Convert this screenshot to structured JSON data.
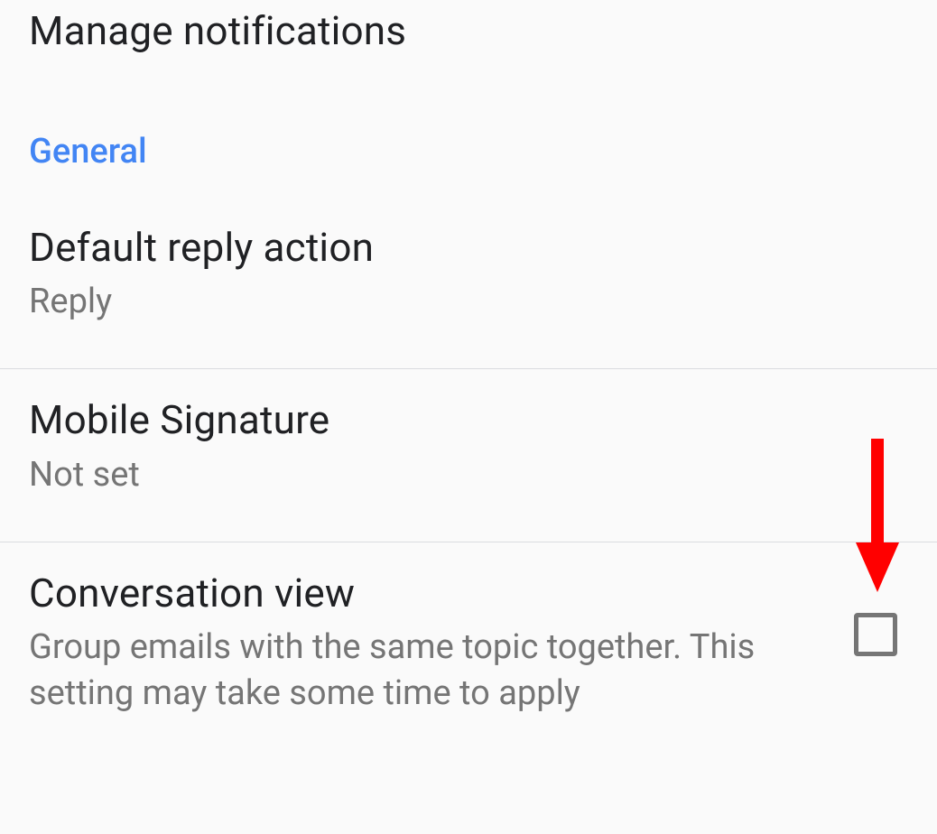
{
  "settings": {
    "manage_notifications": {
      "title": "Manage notifications"
    },
    "section_general": {
      "label": "General"
    },
    "default_reply_action": {
      "title": "Default reply action",
      "value": "Reply"
    },
    "mobile_signature": {
      "title": "Mobile Signature",
      "value": "Not set"
    },
    "conversation_view": {
      "title": "Conversation view",
      "description": "Group emails with the same topic together. This setting may take some time to apply",
      "checked": false
    }
  }
}
